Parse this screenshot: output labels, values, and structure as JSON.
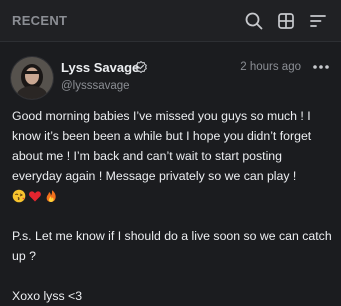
{
  "header": {
    "title": "RECENT",
    "icons": [
      "search-icon",
      "grid-view-icon",
      "sort-icon"
    ]
  },
  "colors": {
    "background": "#1b1c1f",
    "header_background": "#202124",
    "text_primary": "#eceef1",
    "text_secondary": "#8b8e94",
    "icon": "#c7c9cd"
  },
  "post": {
    "author": {
      "name": "Lyss Savage",
      "handle": "@lysssavage",
      "verified_icon": "verified-check-icon"
    },
    "timestamp": "2 hours ago",
    "menu_icon": "more-horizontal-icon",
    "body": {
      "paragraph1": "Good morning babies I’ve missed you guys so much ! I know it’s been been a while but I hope you didn’t forget about me ! I’m back and can’t wait to start posting everyday again ! Message privately so we can play !",
      "emojis": [
        "kissing-face-emoji",
        "red-heart-emoji",
        "fire-emoji"
      ],
      "paragraph2": "P.s. Let me know if I should do a live soon so we can catch up ?",
      "signoff": "Xoxo lyss <3"
    }
  }
}
